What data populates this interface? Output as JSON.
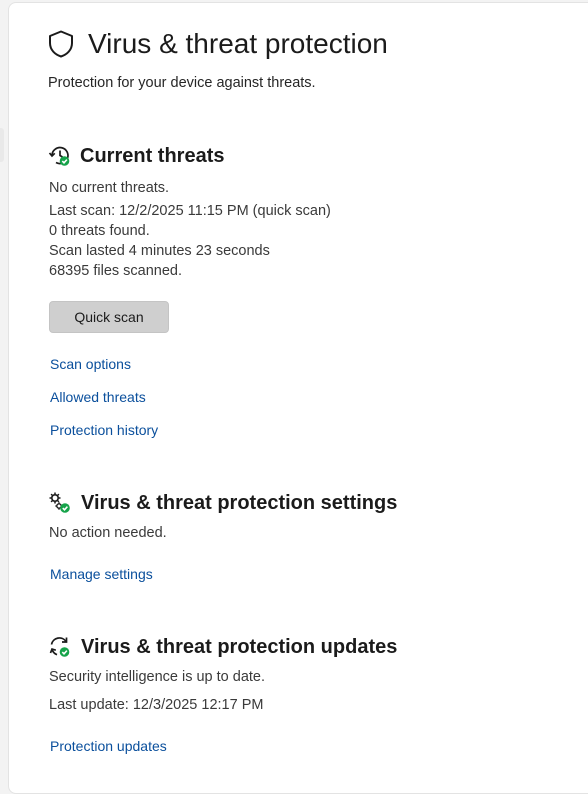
{
  "page": {
    "title": "Virus & threat protection",
    "subtitle": "Protection for your device against threats."
  },
  "current_threats": {
    "title": "Current threats",
    "status": "No current threats.",
    "last_scan": "Last scan: 12/2/2025 11:15 PM (quick scan)",
    "threats_found": "0 threats found.",
    "scan_duration": "Scan lasted 4 minutes 23 seconds",
    "files_scanned": "68395 files scanned.",
    "quick_scan_label": "Quick scan",
    "links": [
      "Scan options",
      "Allowed threats",
      "Protection history"
    ]
  },
  "settings": {
    "title": "Virus & threat protection settings",
    "status": "No action needed.",
    "link": "Manage settings"
  },
  "updates": {
    "title": "Virus & threat protection updates",
    "status": "Security intelligence is up to date.",
    "last_update": "Last update: 12/3/2025 12:17 PM",
    "link": "Protection updates"
  },
  "icons": {
    "header": "shield-icon",
    "current_threats": "history-check-icon",
    "settings": "gears-check-icon",
    "updates": "refresh-check-icon"
  },
  "colors": {
    "link": "#0a4f9c",
    "status_ok": "#16a34a",
    "button_bg": "#cfcfcf"
  }
}
